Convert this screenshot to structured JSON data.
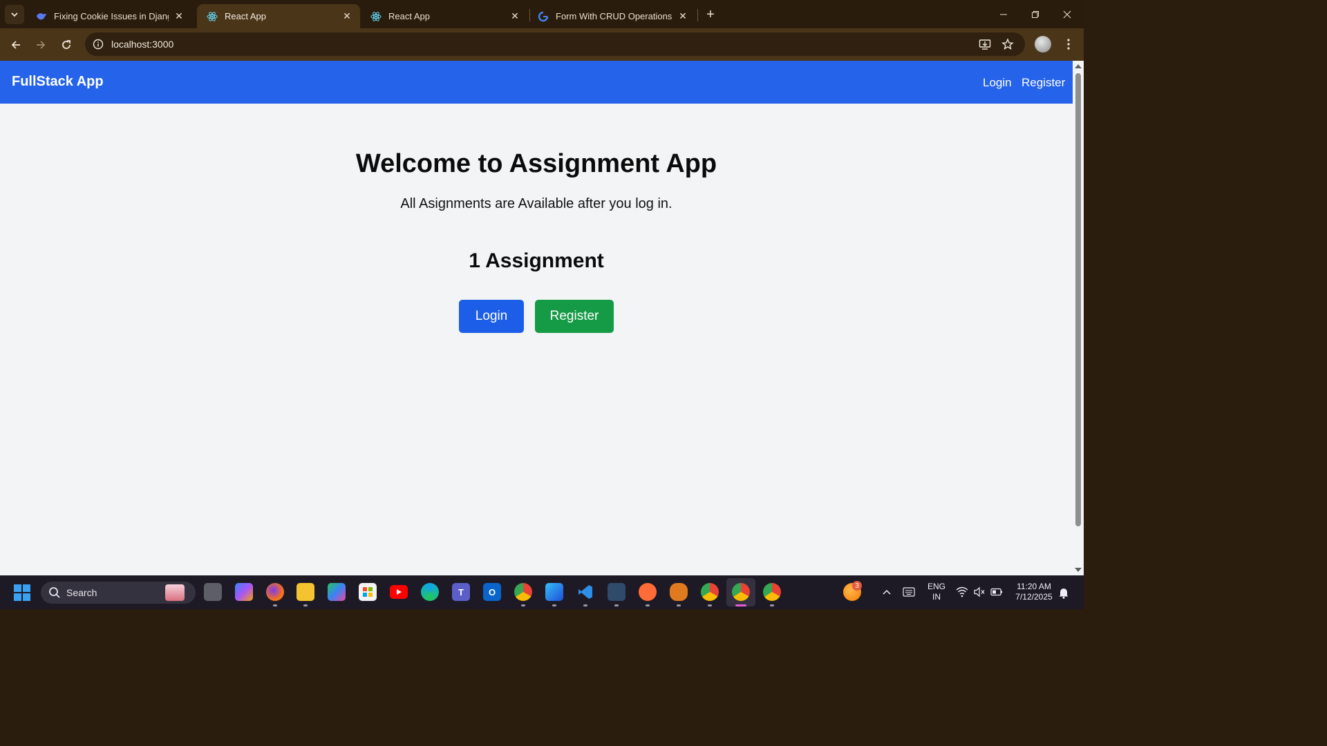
{
  "browser": {
    "tabs": [
      {
        "title": "Fixing Cookie Issues in Django B",
        "favicon": "deepseek-icon",
        "active": false
      },
      {
        "title": "React App",
        "favicon": "react-icon",
        "active": true
      },
      {
        "title": "React App",
        "favicon": "react-icon",
        "active": false
      },
      {
        "title": "Form With CRUD Operations - Go",
        "favicon": "google-icon",
        "active": false
      }
    ],
    "url": "localhost:3000"
  },
  "app": {
    "brand": "FullStack App",
    "nav": {
      "login": "Login",
      "register": "Register"
    },
    "hero": {
      "title": "Welcome to Assignment App",
      "subtitle": "All Asignments are Available after you log in."
    },
    "assignment_count": "1 Assignment",
    "buttons": {
      "login": "Login",
      "register": "Register"
    },
    "colors": {
      "nav": "#2563eb",
      "login_button": "#1d5ee8",
      "register_button": "#159a45",
      "page_bg": "#f3f4f6"
    }
  },
  "taskbar": {
    "search_label": "Search",
    "weather_badge": "3",
    "language": "ENG",
    "region": "IN",
    "time": "11:20 AM",
    "date": "7/12/2025",
    "pinned_apps": [
      "task-view",
      "copilot",
      "firefox",
      "file-explorer",
      "microsoft-365",
      "microsoft-store",
      "youtube",
      "edge",
      "teams",
      "outlook",
      "chrome-profile",
      "photos",
      "vscode",
      "mysql-workbench",
      "postman",
      "brave",
      "chrome",
      "chrome-active",
      "chrome-profile-2"
    ]
  }
}
